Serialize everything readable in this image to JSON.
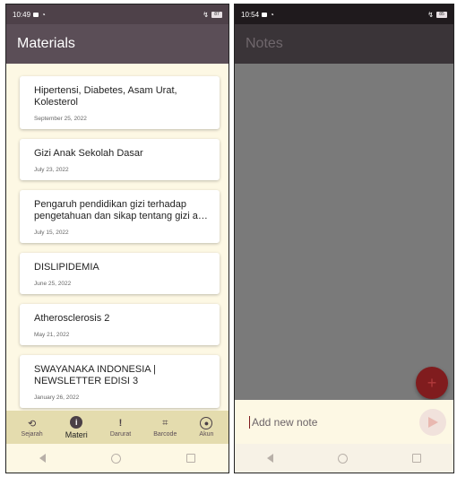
{
  "left": {
    "status_time": "10:49",
    "status_battery": "87",
    "appbar_title": "Materials",
    "materials": [
      {
        "title": "Hipertensi, Diabetes, Asam Urat, Kolesterol",
        "date": "September 25, 2022"
      },
      {
        "title": "Gizi Anak Sekolah Dasar",
        "date": "July 23, 2022"
      },
      {
        "title": "Pengaruh pendidikan gizi terhadap pengetahuan dan sikap tentang gizi a…",
        "date": "July 15, 2022"
      },
      {
        "title": "DISLIPIDEMIA",
        "date": "June 25, 2022"
      },
      {
        "title": "Atherosclerosis 2",
        "date": "May 21, 2022"
      },
      {
        "title": "SWAYANAKA INDONESIA | NEWSLETTER EDISI 3",
        "date": "January 26, 2022"
      }
    ],
    "bottom_nav": [
      {
        "label": "Sejarah",
        "icon": "history-icon",
        "active": false
      },
      {
        "label": "Materi",
        "icon": "info-icon",
        "active": true
      },
      {
        "label": "Darurat",
        "icon": "exclamation-icon",
        "active": false
      },
      {
        "label": "Barcode",
        "icon": "qr-scan-icon",
        "active": false
      },
      {
        "label": "Akun",
        "icon": "account-icon",
        "active": false
      }
    ]
  },
  "right": {
    "status_time": "10:54",
    "status_battery": "85",
    "appbar_title": "Notes",
    "fab_icon": "+",
    "input_placeholder": "Add new note"
  },
  "colors": {
    "appbar": "#5b4e57",
    "bottom_nav_bg": "#e4dcae",
    "fab": "#801c1e",
    "background": "#fdf8e4"
  }
}
